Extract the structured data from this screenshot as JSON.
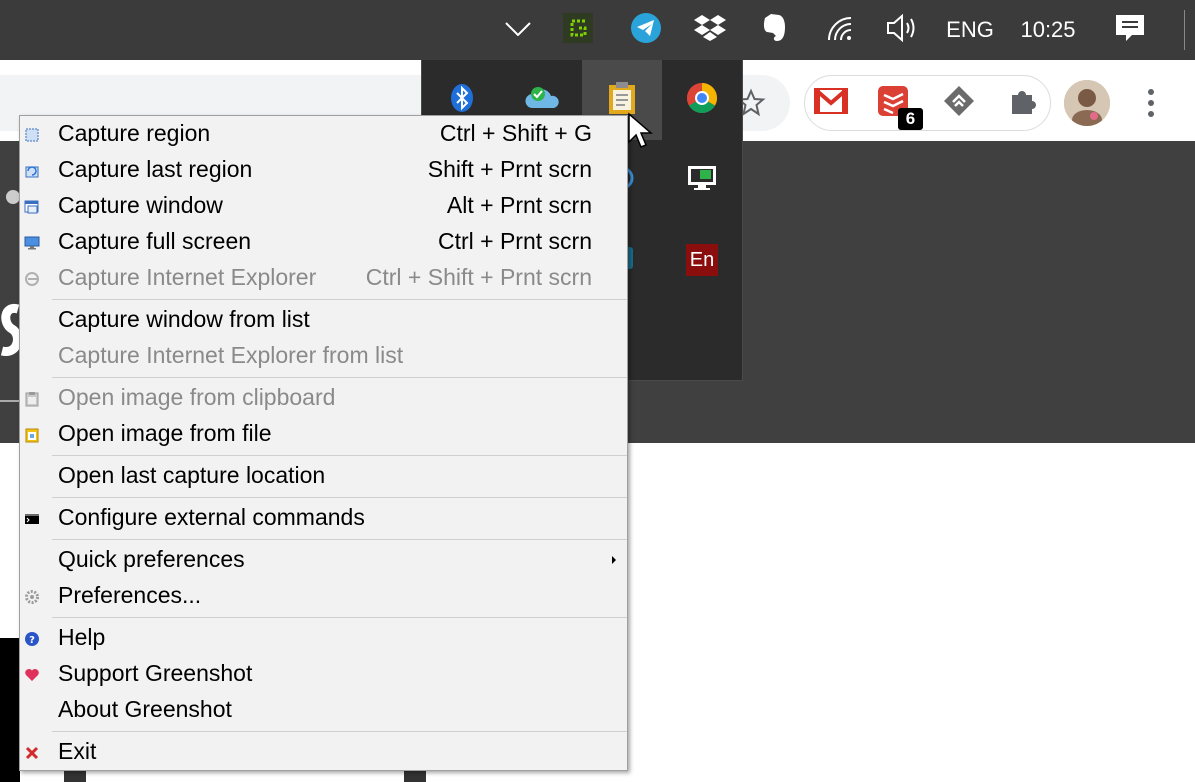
{
  "taskbar": {
    "tray_icons": [
      "chevron-up-icon",
      "greenshot-icon",
      "telegram-icon",
      "dropbox-icon",
      "evernote-icon",
      "wifi-icon",
      "volume-icon"
    ],
    "language": "ENG",
    "clock": "10:25",
    "notification_icon": "action-center-icon"
  },
  "tray_flyout": {
    "icons": [
      "bluetooth-icon",
      "onedrive-icon",
      "clipboard-icon",
      "chrome-icon",
      "network-icon",
      "monitor-icon",
      "app-icon",
      "en-icon"
    ],
    "en_label": "En"
  },
  "chrome": {
    "extensions": [
      "gmail-icon",
      "todoist-icon",
      "feedly-icon",
      "puzzle-icon"
    ],
    "todoist_badge": "6",
    "bookmark_icon": "star-icon"
  },
  "menu": {
    "groups": [
      [
        {
          "label": "Capture region",
          "shortcut": "Ctrl + Shift + G",
          "icon": "region-icon",
          "disabled": false
        },
        {
          "label": "Capture last region",
          "shortcut": "Shift + Prnt scrn",
          "icon": "last-region-icon",
          "disabled": false
        },
        {
          "label": "Capture window",
          "shortcut": "Alt + Prnt scrn",
          "icon": "window-icon",
          "disabled": false
        },
        {
          "label": "Capture full screen",
          "shortcut": "Ctrl + Prnt scrn",
          "icon": "fullscreen-icon",
          "disabled": false
        },
        {
          "label": "Capture Internet Explorer",
          "shortcut": "Ctrl + Shift + Prnt scrn",
          "icon": "ie-icon",
          "disabled": true
        }
      ],
      [
        {
          "label": "Capture window from list",
          "shortcut": "",
          "icon": "",
          "disabled": false
        },
        {
          "label": "Capture Internet Explorer from list",
          "shortcut": "",
          "icon": "",
          "disabled": true
        }
      ],
      [
        {
          "label": "Open image from clipboard",
          "shortcut": "",
          "icon": "clipboard-icon",
          "disabled": true
        },
        {
          "label": "Open image from file",
          "shortcut": "",
          "icon": "open-file-icon",
          "disabled": false
        }
      ],
      [
        {
          "label": "Open last capture location",
          "shortcut": "",
          "icon": "",
          "disabled": false
        }
      ],
      [
        {
          "label": "Configure external commands",
          "shortcut": "",
          "icon": "terminal-icon",
          "disabled": false
        }
      ],
      [
        {
          "label": "Quick preferences",
          "shortcut": "",
          "icon": "",
          "disabled": false,
          "submenu": true
        },
        {
          "label": "Preferences...",
          "shortcut": "",
          "icon": "gear-icon",
          "disabled": false
        }
      ],
      [
        {
          "label": "Help",
          "shortcut": "",
          "icon": "help-icon",
          "disabled": false
        },
        {
          "label": "Support Greenshot",
          "shortcut": "",
          "icon": "heart-icon",
          "disabled": false
        },
        {
          "label": "About Greenshot",
          "shortcut": "",
          "icon": "",
          "disabled": false
        }
      ],
      [
        {
          "label": "Exit",
          "shortcut": "",
          "icon": "exit-icon",
          "disabled": false
        }
      ]
    ]
  },
  "colors": {
    "taskbar": "#3b3b3b",
    "menu_bg": "#f2f2f2",
    "disabled_text": "#8a8a8a",
    "greenshot_green": "#7fd000",
    "telegram_blue": "#2aa3db"
  }
}
